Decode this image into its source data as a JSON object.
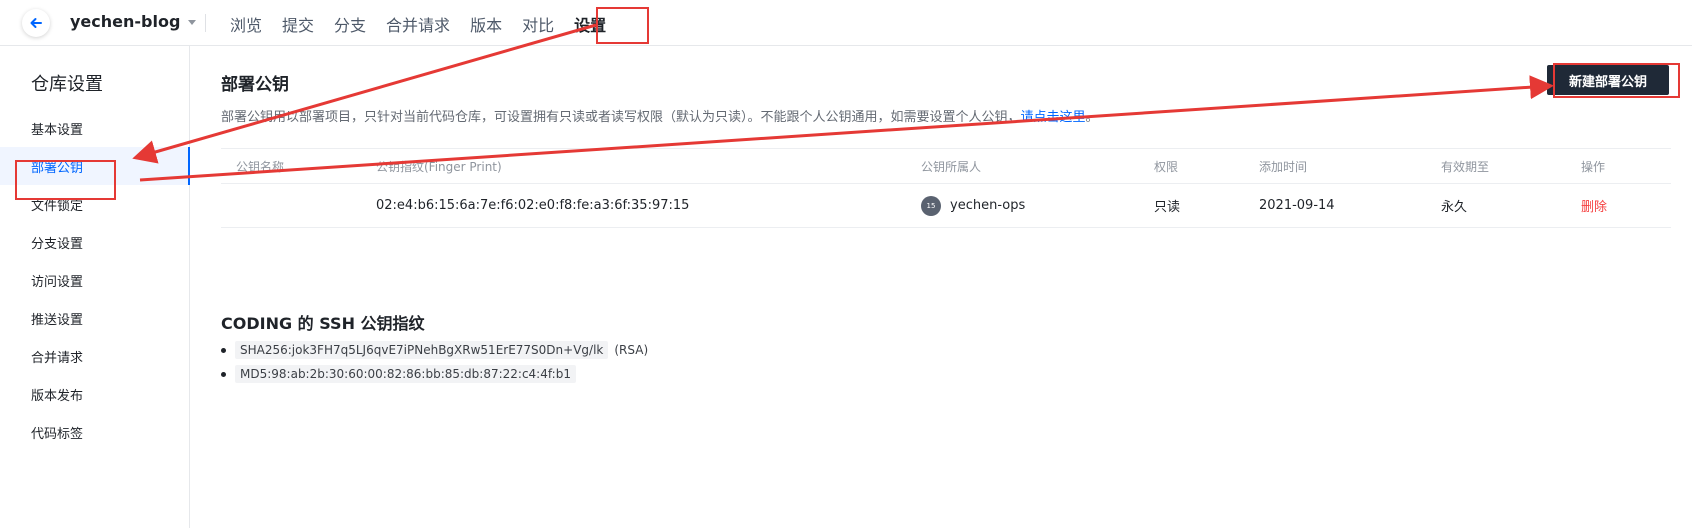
{
  "header": {
    "repo_name": "yechen-blog",
    "tabs": [
      "浏览",
      "提交",
      "分支",
      "合并请求",
      "版本",
      "对比",
      "设置"
    ],
    "active_tab": "设置"
  },
  "sidebar": {
    "title": "仓库设置",
    "items": [
      "基本设置",
      "部署公钥",
      "文件锁定",
      "分支设置",
      "访问设置",
      "推送设置",
      "合并请求",
      "版本发布",
      "代码标签"
    ],
    "active_item": "部署公钥"
  },
  "main": {
    "title": "部署公钥",
    "description": "部署公钥用以部署项目，只针对当前代码仓库，可设置拥有只读或者读写权限（默认为只读）。不能跟个人公钥通用，如需要设置个人公钥，",
    "description_link": "请点击这里",
    "description_end": "。",
    "new_button": "新建部署公钥",
    "table": {
      "headers": [
        "公钥名称",
        "公钥指纹(Finger Print)",
        "公钥所属人",
        "权限",
        "添加时间",
        "有效期至",
        "操作"
      ],
      "rows": [
        {
          "name": "",
          "fingerprint": "02:e4:b6:15:6a:7e:f6:02:e0:f8:fe:a3:6f:35:97:15",
          "owner_avatar": "15",
          "owner": "yechen-ops",
          "permission": "只读",
          "added": "2021-09-14",
          "expires": "永久",
          "action": "删除"
        }
      ]
    },
    "ssh": {
      "title": "CODING 的 SSH 公钥指纹",
      "items": [
        {
          "code": "SHA256:jok3FH7q5LJ6qvE7iPNehBgXRw51ErE77S0Dn+Vg/lk",
          "suffix": "(RSA)"
        },
        {
          "code": "MD5:98:ab:2b:30:60:00:82:86:bb:85:db:87:22:c4:4f:b1",
          "suffix": ""
        }
      ]
    }
  },
  "colors": {
    "accent": "#0066ff",
    "annotation": "#e53935",
    "button_bg": "#1f2937",
    "danger": "#f53f3f"
  }
}
